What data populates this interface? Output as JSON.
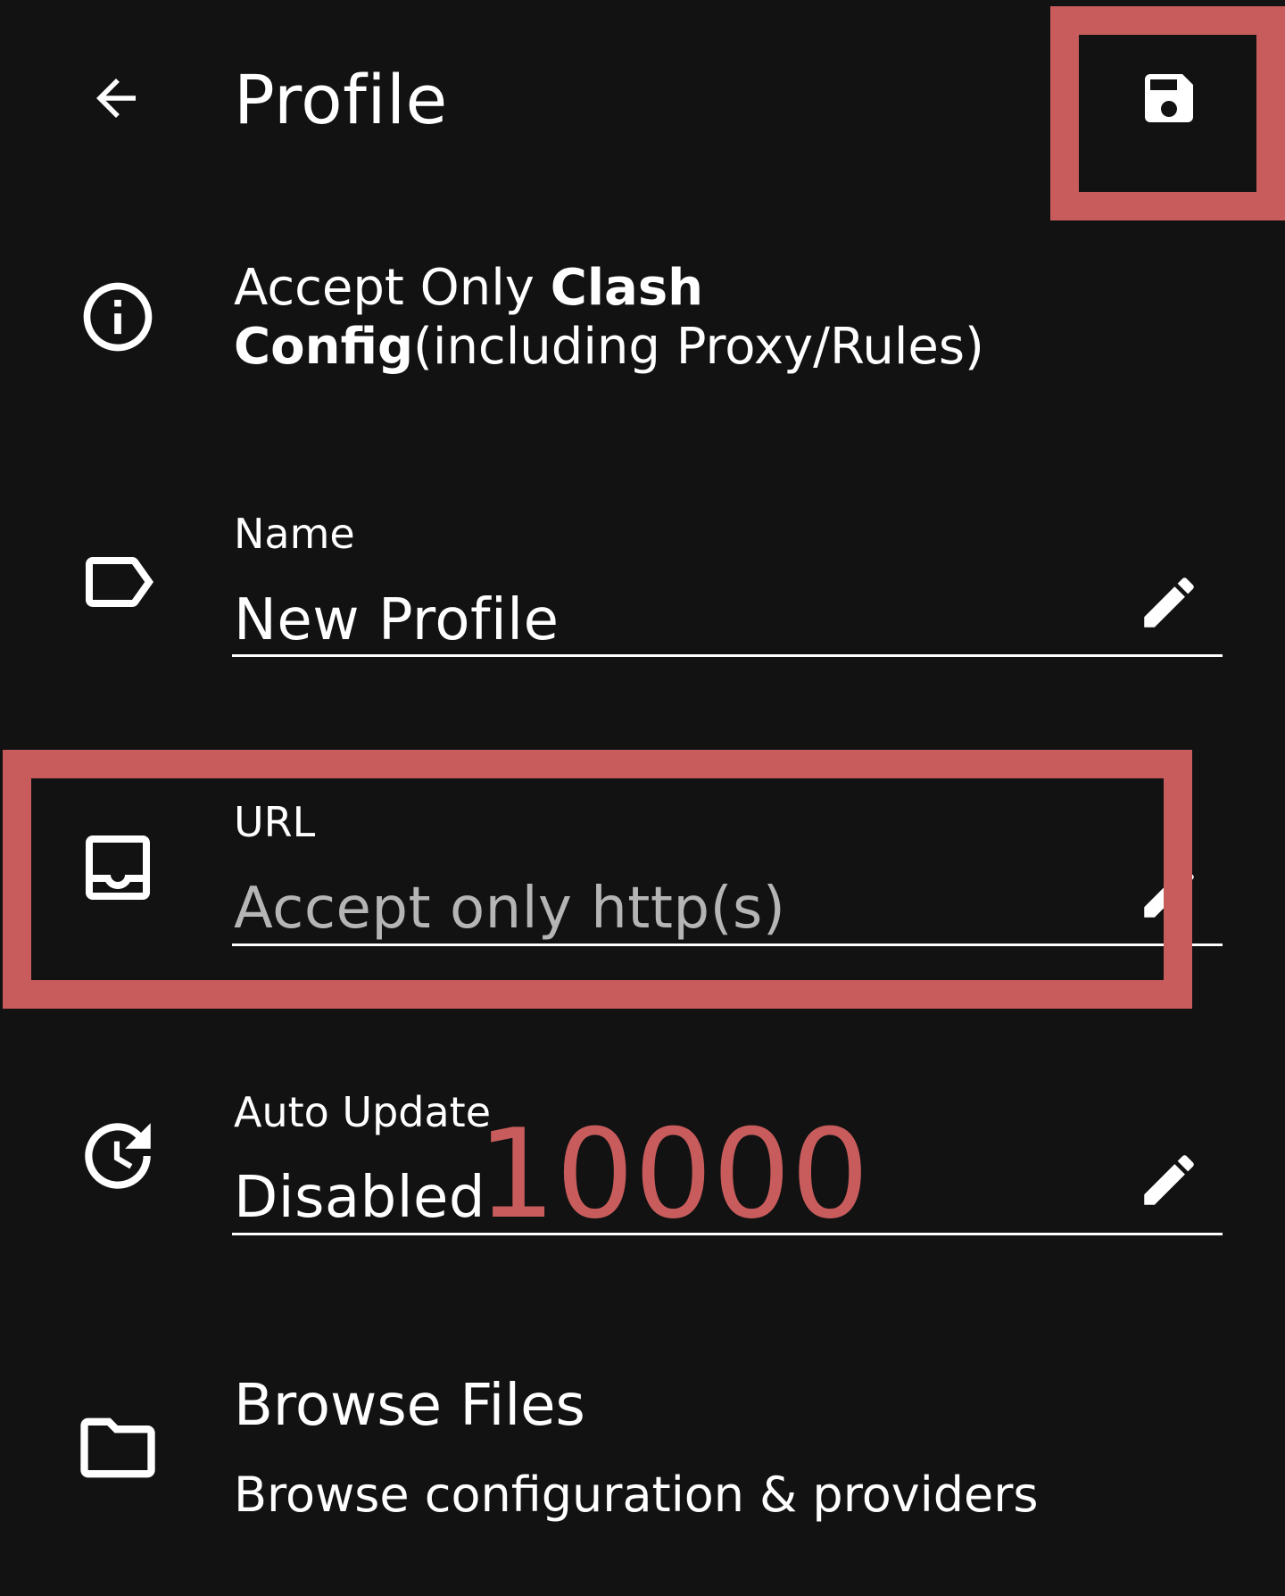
{
  "toolbar": {
    "title": "Profile",
    "back_icon": "arrow-back-icon",
    "save_icon": "save-icon"
  },
  "info": {
    "icon": "info-icon",
    "text_prefix": "Accept Only ",
    "text_bold": "Clash Config",
    "text_suffix": "(including Proxy/Rules)"
  },
  "fields": {
    "name": {
      "icon": "label-icon",
      "label": "Name",
      "value": "New Profile"
    },
    "url": {
      "icon": "inbox-icon",
      "label": "URL",
      "placeholder": "Accept only http(s)"
    },
    "auto_update": {
      "icon": "update-icon",
      "label": "Auto Update",
      "value": "Disabled"
    }
  },
  "browse": {
    "icon": "folder-icon",
    "title": "Browse Files",
    "subtitle": "Browse configuration & providers"
  },
  "annotations": {
    "number_label": "10000",
    "color": "#c85c5c"
  }
}
